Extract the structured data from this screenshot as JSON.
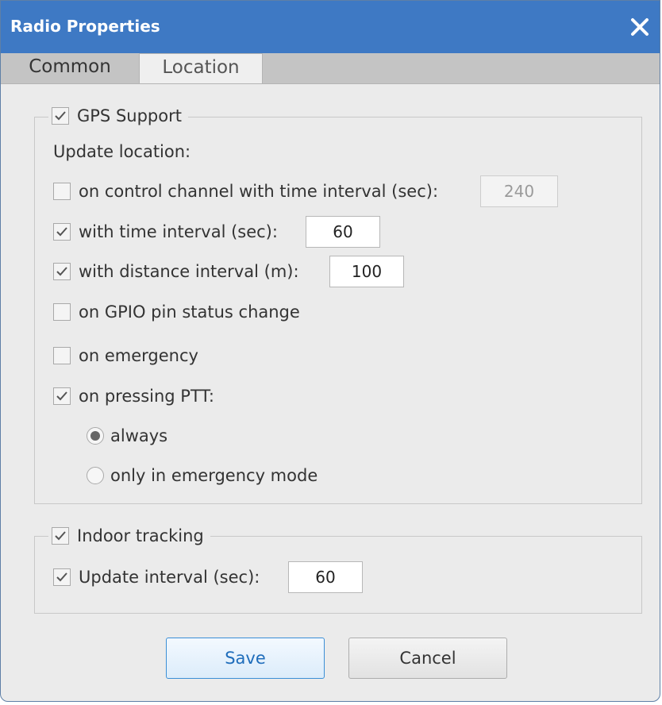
{
  "window": {
    "title": "Radio Properties"
  },
  "tabs": [
    {
      "label": "Common",
      "active": true
    },
    {
      "label": "Location",
      "active": false
    }
  ],
  "gps": {
    "label": "GPS Support",
    "checked": true,
    "update_label": "Update location:",
    "control_channel": {
      "label": "on control channel with time interval (sec):",
      "checked": false,
      "value": "240",
      "enabled": false
    },
    "time_interval": {
      "label": "with time interval (sec):",
      "checked": true,
      "value": "60"
    },
    "distance_interval": {
      "label": "with distance interval (m):",
      "checked": true,
      "value": "100"
    },
    "gpio": {
      "label": "on GPIO pin status change",
      "checked": false
    },
    "emergency": {
      "label": "on emergency",
      "checked": false
    },
    "ptt": {
      "label": "on pressing PTT:",
      "checked": true
    },
    "ptt_always": {
      "label": "always",
      "selected": true
    },
    "ptt_emergency_only": {
      "label": "only in emergency mode",
      "selected": false
    }
  },
  "indoor": {
    "label": "Indoor tracking",
    "checked": true,
    "update_interval": {
      "label": "Update interval (sec):",
      "checked": true,
      "value": "60"
    }
  },
  "buttons": {
    "save": "Save",
    "cancel": "Cancel"
  },
  "colors": {
    "titlebar": "#3e79c4",
    "window_bg": "#ebebeb",
    "save_accent": "#1f6dbb"
  }
}
